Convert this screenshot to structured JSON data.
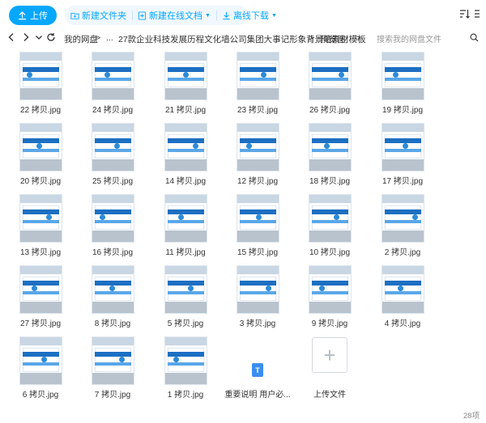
{
  "toolbar": {
    "upload_label": "上传",
    "new_folder_label": "新建文件夹",
    "new_online_doc_label": "新建在线文档",
    "offline_download_label": "离线下载"
  },
  "breadcrumb": {
    "root": "我的网盘",
    "sep1": ">",
    "ellipsis": "...",
    "folder": "27款企业科技发展历程文化墙公司集团大事记形象背景墙素材模板",
    "sep2": ">",
    "current": "预览图",
    "sep3": ">"
  },
  "search": {
    "placeholder": "搜索我的网盘文件"
  },
  "files": [
    {
      "name": "22 拷贝.jpg"
    },
    {
      "name": "24 拷贝.jpg"
    },
    {
      "name": "21 拷贝.jpg"
    },
    {
      "name": "23 拷贝.jpg"
    },
    {
      "name": "26 拷贝.jpg"
    },
    {
      "name": "19 拷贝.jpg"
    },
    {
      "name": "20 拷贝.jpg"
    },
    {
      "name": "25 拷贝.jpg"
    },
    {
      "name": "14 拷贝.jpg"
    },
    {
      "name": "12 拷贝.jpg"
    },
    {
      "name": "18 拷贝.jpg"
    },
    {
      "name": "17 拷贝.jpg"
    },
    {
      "name": "13 拷贝.jpg"
    },
    {
      "name": "16 拷贝.jpg"
    },
    {
      "name": "11 拷贝.jpg"
    },
    {
      "name": "15 拷贝.jpg"
    },
    {
      "name": "10 拷贝.jpg"
    },
    {
      "name": "2 拷贝.jpg"
    },
    {
      "name": "27 拷贝.jpg"
    },
    {
      "name": "8 拷贝.jpg"
    },
    {
      "name": "5 拷贝.jpg"
    },
    {
      "name": "3 拷贝.jpg"
    },
    {
      "name": "9 拷贝.jpg"
    },
    {
      "name": "4 拷贝.jpg"
    },
    {
      "name": "6 拷贝.jpg"
    },
    {
      "name": "7 拷贝.jpg"
    },
    {
      "name": "1 拷贝.jpg"
    }
  ],
  "doc_file": {
    "name": "重要说明 用户必...",
    "icon_label": "T"
  },
  "upload_tile": {
    "label": "上传文件"
  },
  "footer": {
    "count": "28项"
  },
  "colors": {
    "accent": "#06a7ff",
    "thumb_blue": "#1c6fc2"
  }
}
